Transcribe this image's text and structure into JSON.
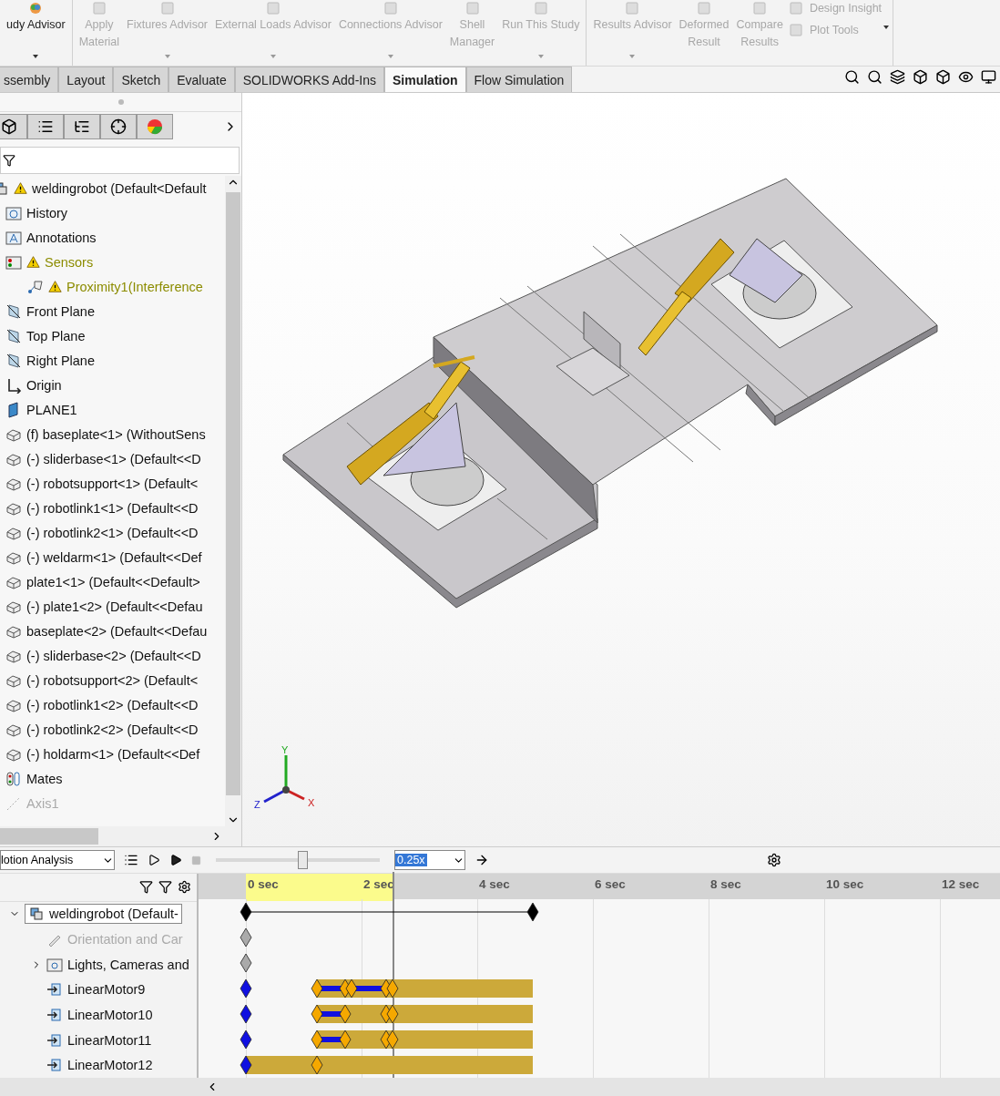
{
  "ribbon": {
    "groups": [
      {
        "items": [
          {
            "label": "udy Advisor",
            "disabled": false,
            "dropdown": true
          }
        ]
      },
      {
        "items": [
          {
            "label": "Apply\nMaterial",
            "disabled": true,
            "dropdown": false
          },
          {
            "label": "Fixtures Advisor",
            "disabled": true,
            "dropdown": true
          },
          {
            "label": "External Loads Advisor",
            "disabled": true,
            "dropdown": true
          },
          {
            "label": "Connections Advisor",
            "disabled": true,
            "dropdown": true
          },
          {
            "label": "Shell\nManager",
            "disabled": true,
            "dropdown": false
          },
          {
            "label": "Run This Study",
            "disabled": true,
            "dropdown": true
          }
        ]
      },
      {
        "items": [
          {
            "label": "Results Advisor",
            "disabled": true,
            "dropdown": true
          },
          {
            "label": "Deformed\nResult",
            "disabled": true,
            "dropdown": false
          },
          {
            "label": "Compare\nResults",
            "disabled": true,
            "dropdown": false
          }
        ],
        "small": [
          {
            "label": "Design Insight",
            "disabled": true
          },
          {
            "label": "Plot Tools",
            "disabled": true
          }
        ]
      }
    ]
  },
  "tabs": [
    {
      "label": "ssembly",
      "selected": false
    },
    {
      "label": "Layout",
      "selected": false
    },
    {
      "label": "Sketch",
      "selected": false
    },
    {
      "label": "Evaluate",
      "selected": false
    },
    {
      "label": "SOLIDWORKS Add-Ins",
      "selected": false
    },
    {
      "label": "Simulation",
      "selected": true
    },
    {
      "label": "Flow Simulation",
      "selected": false
    }
  ],
  "tree": {
    "items": [
      {
        "kind": "assembly",
        "label": "weldingrobot  (Default<Default",
        "warning": true,
        "disabled": false
      },
      {
        "kind": "history",
        "label": "History",
        "warning": false,
        "disabled": false
      },
      {
        "kind": "annotations",
        "label": "Annotations",
        "warning": false,
        "disabled": false
      },
      {
        "kind": "sensors",
        "label": "Sensors",
        "warning": true,
        "disabled": false,
        "color": "#8c8c00"
      },
      {
        "kind": "proximity",
        "label": "Proximity1(Interference",
        "warning": true,
        "disabled": false,
        "color": "#8c8c00"
      },
      {
        "kind": "plane",
        "label": "Front Plane",
        "warning": false,
        "disabled": false
      },
      {
        "kind": "plane",
        "label": "Top Plane",
        "warning": false,
        "disabled": false
      },
      {
        "kind": "plane",
        "label": "Right Plane",
        "warning": false,
        "disabled": false
      },
      {
        "kind": "origin",
        "label": "Origin",
        "warning": false,
        "disabled": false
      },
      {
        "kind": "sketchplane",
        "label": "PLANE1",
        "warning": false,
        "disabled": false
      },
      {
        "kind": "part",
        "label": "(f) baseplate<1> (WithoutSens",
        "warning": false,
        "disabled": false
      },
      {
        "kind": "part",
        "label": "(-) sliderbase<1> (Default<<D",
        "warning": false,
        "disabled": false
      },
      {
        "kind": "part",
        "label": "(-) robotsupport<1> (Default<",
        "warning": false,
        "disabled": false
      },
      {
        "kind": "part",
        "label": "(-) robotlink1<1> (Default<<D",
        "warning": false,
        "disabled": false
      },
      {
        "kind": "part",
        "label": "(-) robotlink2<1> (Default<<D",
        "warning": false,
        "disabled": false
      },
      {
        "kind": "part",
        "label": "(-) weldarm<1> (Default<<Def",
        "warning": false,
        "disabled": false
      },
      {
        "kind": "part",
        "label": "plate1<1> (Default<<Default>",
        "warning": false,
        "disabled": false
      },
      {
        "kind": "part",
        "label": "(-) plate1<2> (Default<<Defau",
        "warning": false,
        "disabled": false
      },
      {
        "kind": "part",
        "label": "baseplate<2> (Default<<Defau",
        "warning": false,
        "disabled": false
      },
      {
        "kind": "part",
        "label": "(-) sliderbase<2> (Default<<D",
        "warning": false,
        "disabled": false
      },
      {
        "kind": "part",
        "label": "(-) robotsupport<2> (Default<",
        "warning": false,
        "disabled": false
      },
      {
        "kind": "part",
        "label": "(-) robotlink1<2> (Default<<D",
        "warning": false,
        "disabled": false
      },
      {
        "kind": "part",
        "label": "(-) robotlink2<2> (Default<<D",
        "warning": false,
        "disabled": false
      },
      {
        "kind": "part",
        "label": "(-) holdarm<1> (Default<<Def",
        "warning": false,
        "disabled": false
      },
      {
        "kind": "mates",
        "label": "Mates",
        "warning": false,
        "disabled": false
      },
      {
        "kind": "axis",
        "label": "Axis1",
        "warning": false,
        "disabled": true
      }
    ]
  },
  "viewport": {
    "triad": [
      "Y",
      "Z",
      "X"
    ]
  },
  "motion": {
    "study_type": "lotion Analysis",
    "speed": "0.25x",
    "slider": {
      "level": 0.52
    },
    "ruler": [
      "0 sec",
      "2 sec",
      "4 sec",
      "6 sec",
      "8 sec",
      "10 sec",
      "12 sec"
    ],
    "rows": [
      {
        "kind": "assembly",
        "label": "weldingrobot  (Default-",
        "disabled": false,
        "expanded": true
      },
      {
        "kind": "orientation",
        "label": "Orientation and Car",
        "disabled": true
      },
      {
        "kind": "lights",
        "label": "Lights, Cameras and",
        "disabled": false,
        "expanded": false
      },
      {
        "kind": "motor",
        "label": "LinearMotor9",
        "disabled": false
      },
      {
        "kind": "motor",
        "label": "LinearMotor10",
        "disabled": false
      },
      {
        "kind": "motor",
        "label": "LinearMotor11",
        "disabled": false
      },
      {
        "kind": "motor",
        "label": "LinearMotor12",
        "disabled": false
      }
    ]
  }
}
